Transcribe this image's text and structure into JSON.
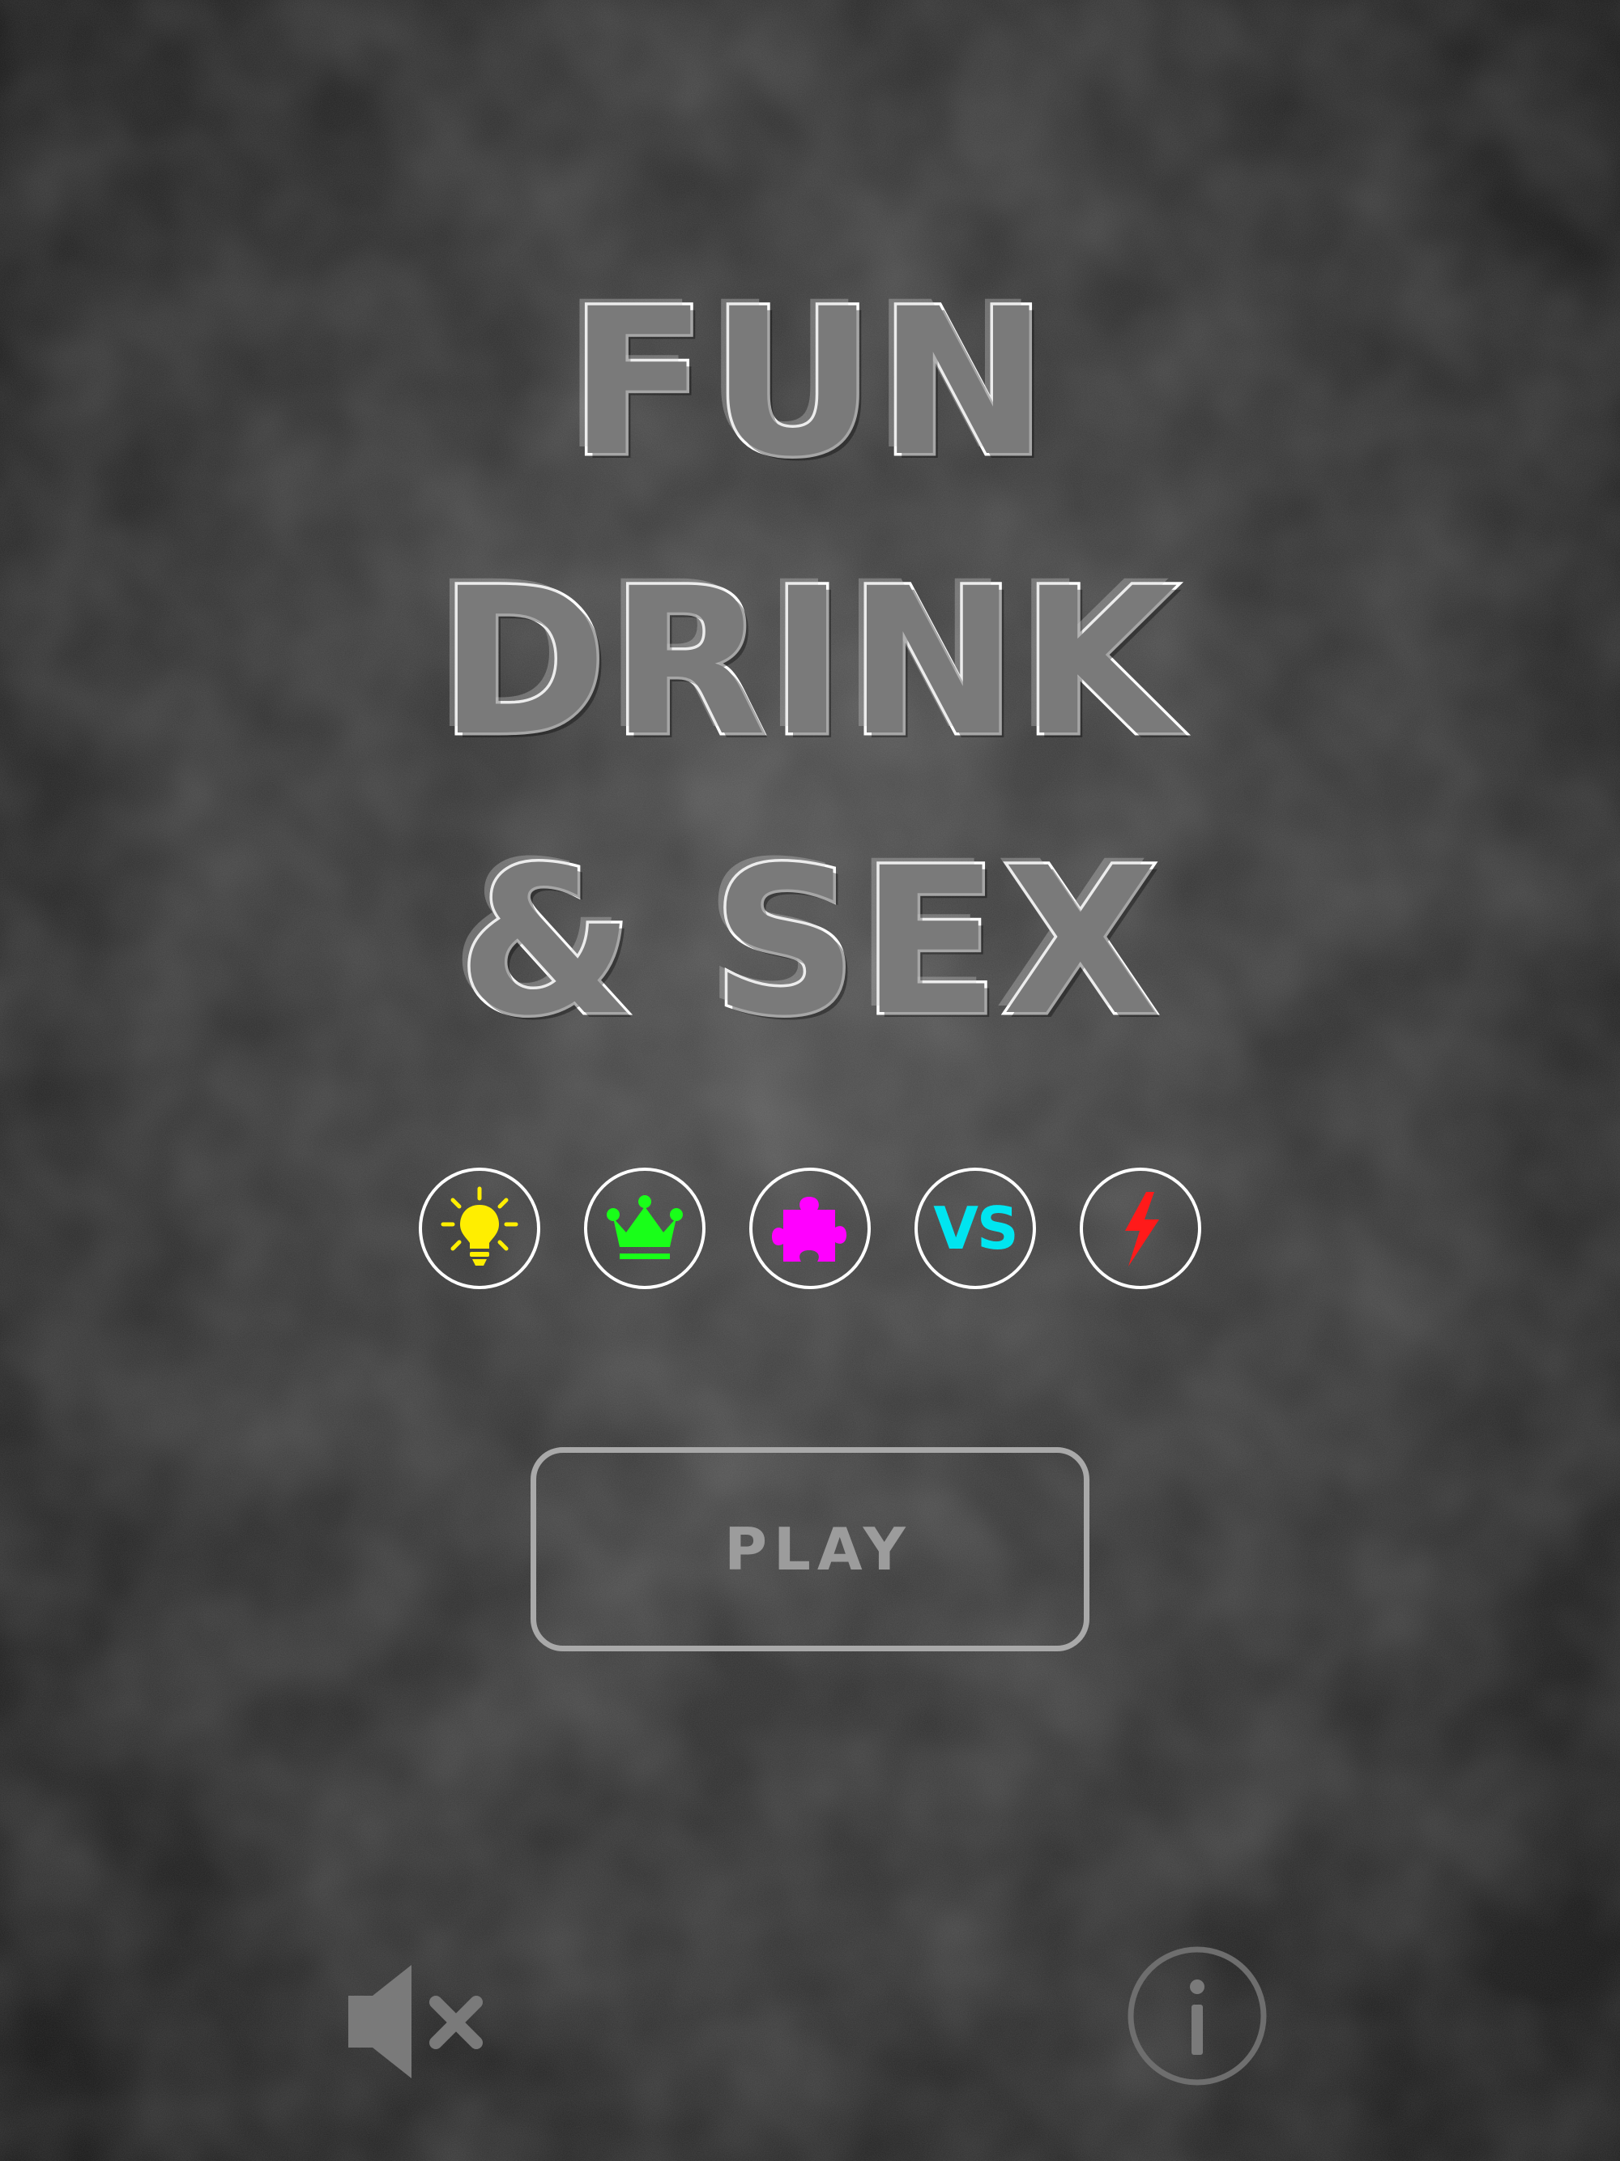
{
  "title": {
    "lines": [
      "FUN",
      "DRINK",
      "& SEX"
    ]
  },
  "mode_icons": [
    {
      "name": "lightbulb-icon",
      "color": "#ffee00"
    },
    {
      "name": "crown-icon",
      "color": "#19ff19"
    },
    {
      "name": "puzzle-piece-icon",
      "color": "#ff00ff"
    },
    {
      "name": "versus-icon",
      "color": "#00e5f0",
      "text": "VS"
    },
    {
      "name": "lightning-bolt-icon",
      "color": "#ff1a1a"
    }
  ],
  "play_button": {
    "label": "PLAY"
  },
  "bottom_controls": {
    "sound_icon": "speaker-muted-icon",
    "info_icon": "info-icon"
  },
  "colors": {
    "background": "#2d2d2d",
    "title_fill": "#7a7a7a",
    "title_outline": "#ffffff",
    "button_outline": "#a9a9a9"
  }
}
